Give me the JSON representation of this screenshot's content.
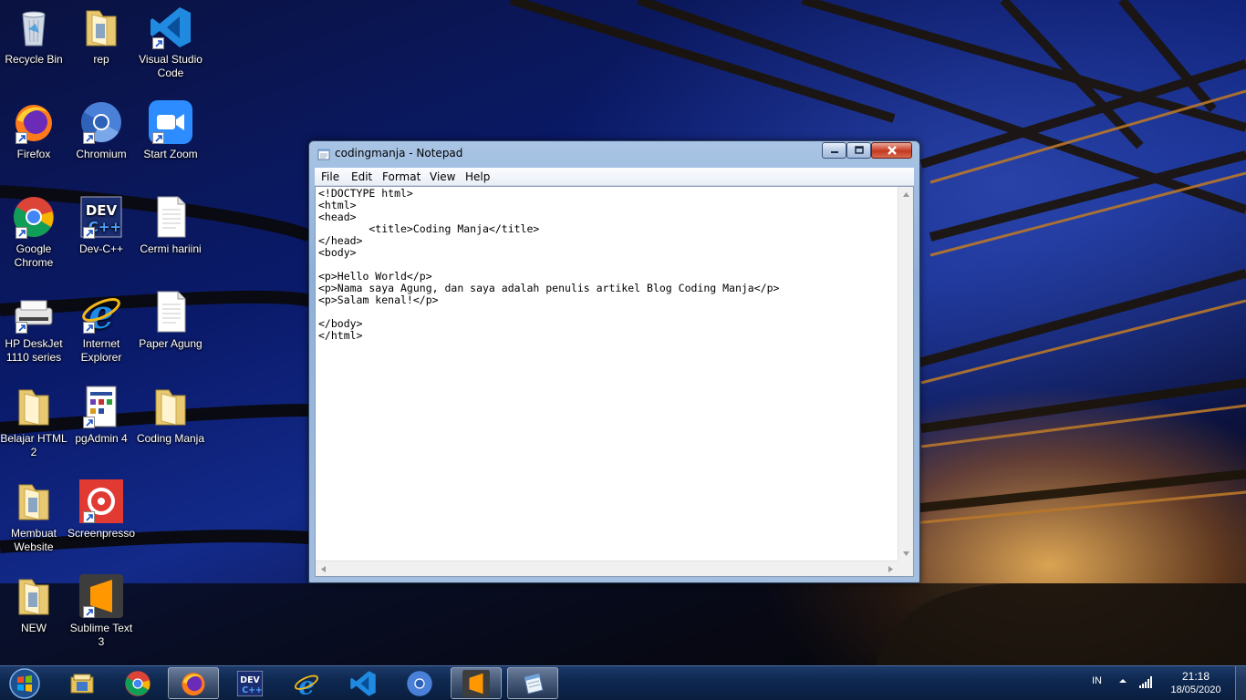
{
  "desktop_icons": [
    {
      "label": "Recycle Bin"
    },
    {
      "label": "rep"
    },
    {
      "label": "Visual Studio Code"
    },
    {
      "label": "Firefox"
    },
    {
      "label": "Chromium"
    },
    {
      "label": "Start Zoom"
    },
    {
      "label": "Google Chrome"
    },
    {
      "label": "Dev-C++"
    },
    {
      "label": "Cermi hariini"
    },
    {
      "label": "HP DeskJet 1110 series"
    },
    {
      "label": "Internet Explorer"
    },
    {
      "label": "Paper Agung"
    },
    {
      "label": "Belajar HTML 2"
    },
    {
      "label": "pgAdmin 4"
    },
    {
      "label": "Coding Manja"
    },
    {
      "label": "Membuat Website"
    },
    {
      "label": "Screenpresso"
    },
    {
      "label": "NEW"
    },
    {
      "label": "Sublime Text 3"
    }
  ],
  "notepad": {
    "title": "codingmanja - Notepad",
    "menu": [
      "File",
      "Edit",
      "Format",
      "View",
      "Help"
    ],
    "content": "<!DOCTYPE html>\n<html>\n<head>\n        <title>Coding Manja</title>\n</head>\n<body>\n\n<p>Hello World</p>\n<p>Nama saya Agung, dan saya adalah penulis artikel Blog Coding Manja</p>\n<p>Salam kenal!</p>\n\n</body>\n</html>"
  },
  "taskbar": {
    "pinned": [
      "Windows Explorer",
      "Google Chrome",
      "Firefox",
      "Dev-C++",
      "Internet Explorer",
      "Visual Studio Code",
      "Chromium",
      "Sublime Text",
      "Notepad"
    ],
    "language": "IN",
    "time": "21:18",
    "date": "18/05/2020"
  },
  "colors": {
    "taskbar": "#0e2850",
    "window_frame": "#a3bedf",
    "close_button": "#c23a22"
  }
}
